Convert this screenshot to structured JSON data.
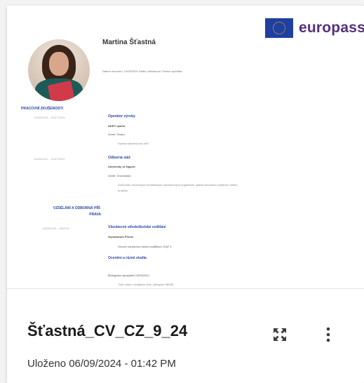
{
  "card": {
    "title": "Šťastná_CV_CZ_9_24",
    "saved_label": "Uloženo 06/09/2024 - 01:42 PM"
  },
  "preview": {
    "logo_text": "europass",
    "name": "Martina Šťastná",
    "meta": "Datum narození: 15/09/2004   Státní příslušnost: Česká republika",
    "sections": {
      "work": "PRACOVNÍ ZKUŠENOSTI",
      "education_line1": "VZDĚLÁNÍ A ODBORNÁ PŘÍ-",
      "education_line2": "PRAVA"
    },
    "jobs": [
      {
        "dates": "13/08/2025 – 31/07/2025",
        "title": "Operátor výroby",
        "employer": "AKEV sports",
        "location": "Země: Česko",
        "desc": "Výroba sekvenčních dílů"
      },
      {
        "dates": "13/09/2022 – 31/07/2022",
        "title": "Odborná stáž",
        "employer": "University of Zagreb",
        "location": "Země: Chorvatsko",
        "desc1": "Ověřování mnohových hematických záznamových organismů, sadebí asociační vyšetření ardiho",
        "desc2": "projektu"
      }
    ],
    "education": [
      {
        "dates": "13/08/2015 – 06/2019",
        "title": "Všeobecné středoškolské vzdělání",
        "school": "Gymnázium Přerov",
        "level": "Úroveň národního rámce kvalifikací: EQF 3"
      }
    ],
    "extra_title": "Ocenění a různé studia",
    "extra_item": "Biologická olympiáda 13/05/2022",
    "extra_desc": "Třetí místo v krajském kole, kategorie MEME"
  },
  "icons": {
    "expand": "expand-icon",
    "more": "more-vert-icon"
  },
  "colors": {
    "europass_blue": "#1f3fa1",
    "europass_purple": "#54307c",
    "section_blue": "#2b47a6"
  }
}
